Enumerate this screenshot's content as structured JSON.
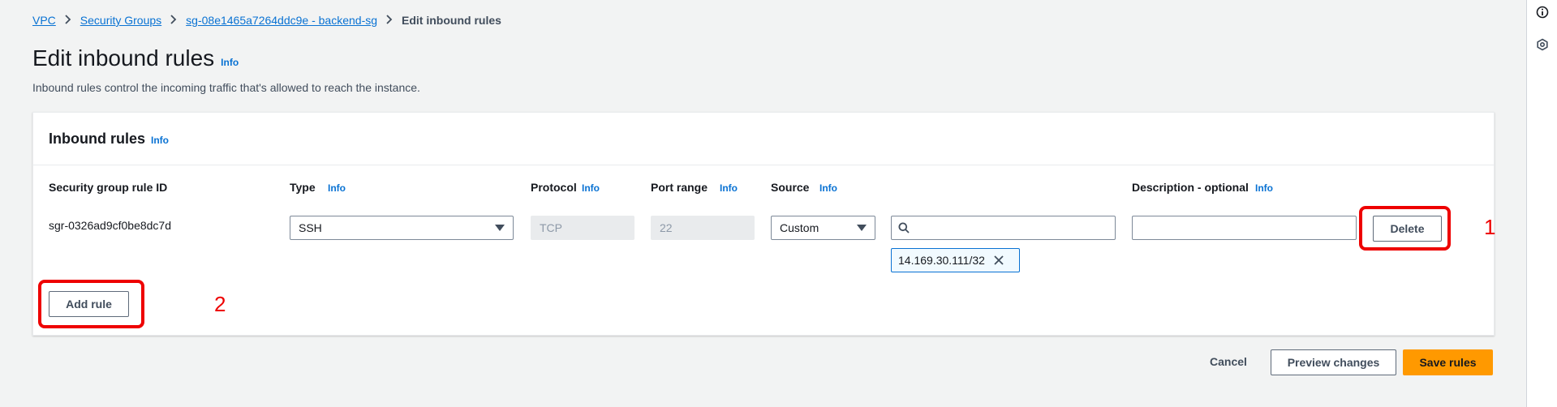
{
  "breadcrumbs": [
    {
      "label": "VPC"
    },
    {
      "label": "Security Groups"
    },
    {
      "label": "sg-08e1465a7264ddc9e - backend-sg"
    }
  ],
  "breadcrumb_current": "Edit inbound rules",
  "page": {
    "title": "Edit inbound rules",
    "info": "Info",
    "description": "Inbound rules control the incoming traffic that's allowed to reach the instance."
  },
  "panel": {
    "title": "Inbound rules",
    "info": "Info",
    "columns": {
      "rule_id": "Security group rule ID",
      "type": "Type",
      "protocol": "Protocol",
      "port_range": "Port range",
      "source": "Source",
      "description": "Description - optional",
      "info": "Info"
    },
    "rule": {
      "id": "sgr-0326ad9cf0be8dc7d",
      "type": "SSH",
      "protocol": "TCP",
      "port_range": "22",
      "source_type": "Custom",
      "source_search_value": "",
      "source_token": "14.169.30.111/32",
      "description_value": "",
      "delete_label": "Delete"
    },
    "add_rule_label": "Add rule"
  },
  "footer": {
    "cancel": "Cancel",
    "preview": "Preview changes",
    "save": "Save rules"
  },
  "annotations": {
    "one": "1",
    "two": "2"
  },
  "colors": {
    "link": "#0972d3",
    "primary": "#ff9900",
    "annotation": "#ee0000"
  },
  "icons": [
    "chevron-right-icon",
    "caret-down-icon",
    "search-icon",
    "close-icon",
    "info-circle-icon",
    "settings-hex-icon"
  ]
}
